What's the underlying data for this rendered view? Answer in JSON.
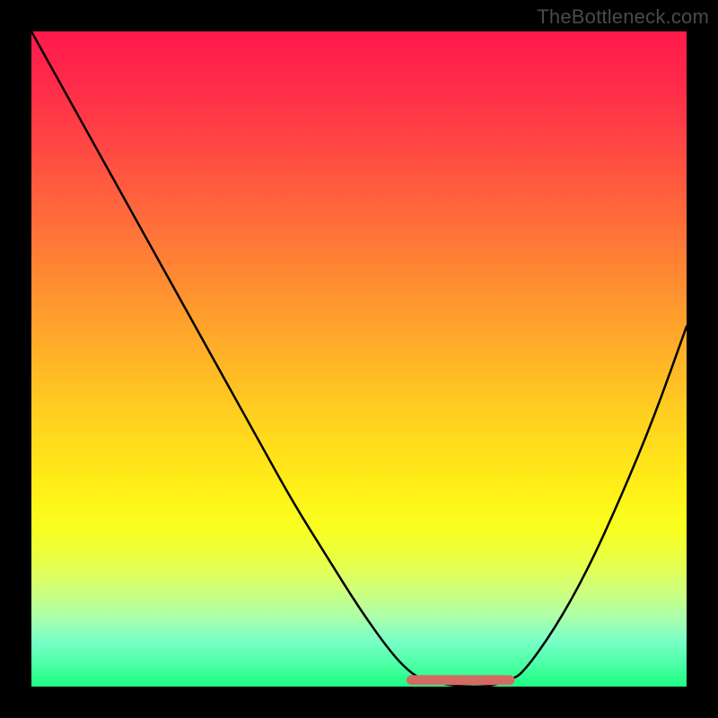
{
  "watermark": "TheBottleneck.com",
  "colors": {
    "background": "#000000",
    "gradient_top": "#ff1a4b",
    "gradient_bottom": "#1dff83",
    "curve": "#000000",
    "flat_segment": "#d36b62"
  },
  "chart_data": {
    "type": "line",
    "title": "",
    "xlabel": "",
    "ylabel": "",
    "xlim": [
      0,
      100
    ],
    "ylim": [
      0,
      100
    ],
    "grid": false,
    "legend": false,
    "series": [
      {
        "name": "bottleneck-curve",
        "x": [
          0,
          5,
          10,
          15,
          20,
          25,
          30,
          35,
          40,
          45,
          50,
          55,
          58,
          60,
          65,
          70,
          73,
          75,
          80,
          85,
          90,
          95,
          100
        ],
        "y": [
          100,
          91,
          82,
          73,
          64,
          55,
          46,
          37,
          28,
          20,
          12,
          5,
          2,
          1,
          0,
          0,
          1,
          2,
          9,
          18,
          29,
          41,
          55
        ]
      }
    ],
    "flat_segment": {
      "x_start": 58,
      "x_end": 73,
      "y": 1
    }
  }
}
